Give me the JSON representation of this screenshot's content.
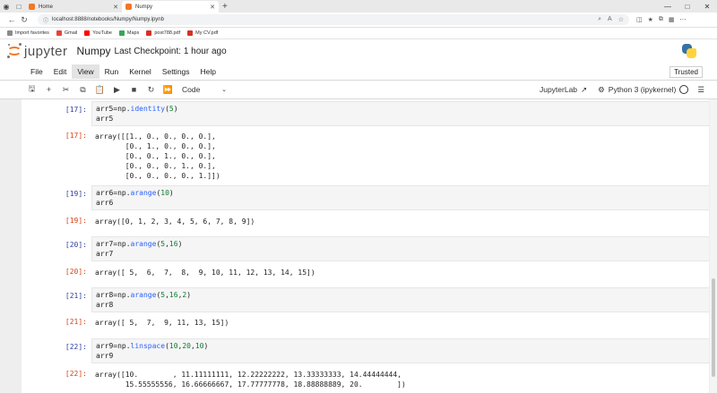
{
  "browser": {
    "tabs": [
      {
        "title": "Home",
        "active": false
      },
      {
        "title": "Numpy",
        "active": true
      }
    ],
    "new_tab_icon": "plus-icon",
    "url": "localhost:8888/notebooks/Numpy/Numpy.ipynb",
    "favorites": [
      "Import favorites",
      "Gmail",
      "YouTube",
      "Maps",
      "post788.pdf",
      "My CV.pdf"
    ]
  },
  "header": {
    "brand": "jupyter",
    "notebook_name": "Numpy",
    "checkpoint": "Last Checkpoint: 1 hour ago"
  },
  "menu": {
    "items": [
      "File",
      "Edit",
      "View",
      "Run",
      "Kernel",
      "Settings",
      "Help"
    ],
    "active": "View",
    "trusted": "Trusted"
  },
  "toolbar": {
    "cell_type": "Code",
    "jupyterlab": "JupyterLab",
    "kernel": "Python 3 (ipykernel)"
  },
  "cells": [
    {
      "in_prompt": "[17]:",
      "code": [
        "arr5=np.identity(5)",
        "arr5"
      ],
      "out_prompt": "[17]:",
      "output": [
        "array([[1., 0., 0., 0., 0.],",
        "       [0., 1., 0., 0., 0.],",
        "       [0., 0., 1., 0., 0.],",
        "       [0., 0., 0., 1., 0.],",
        "       [0., 0., 0., 0., 1.]])"
      ]
    },
    {
      "in_prompt": "[19]:",
      "code": [
        "arr6=np.arange(10)",
        "arr6"
      ],
      "out_prompt": "[19]:",
      "output": [
        "array([0, 1, 2, 3, 4, 5, 6, 7, 8, 9])"
      ]
    },
    {
      "in_prompt": "[20]:",
      "code": [
        "arr7=np.arange(5,16)",
        "arr7"
      ],
      "out_prompt": "[20]:",
      "output": [
        "array([ 5,  6,  7,  8,  9, 10, 11, 12, 13, 14, 15])"
      ]
    },
    {
      "in_prompt": "[21]:",
      "code": [
        "arr8=np.arange(5,16,2)",
        "arr8"
      ],
      "out_prompt": "[21]:",
      "output": [
        "array([ 5,  7,  9, 11, 13, 15])"
      ]
    },
    {
      "in_prompt": "[22]:",
      "code": [
        "arr9=np.linspace(10,20,10)",
        "arr9"
      ],
      "out_prompt": "[22]:",
      "output": [
        "array([10.        , 11.11111111, 12.22222222, 13.33333333, 14.44444444,",
        "       15.55555556, 16.66666667, 17.77777778, 18.88888889, 20.        ])"
      ]
    }
  ]
}
